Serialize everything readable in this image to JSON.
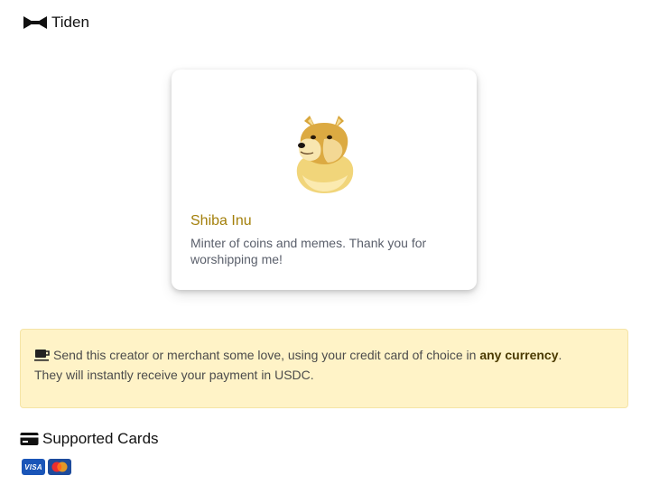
{
  "header": {
    "brand": "Tiden",
    "logo_icon": "bowtie-logo-icon"
  },
  "creator": {
    "name": "Shiba Inu",
    "bio": "Minter of coins and memes. Thank you for worshipping me!",
    "avatar_icon": "shiba-inu-avatar"
  },
  "info": {
    "icon": "coffee-icon",
    "text_before": "Send this creator or merchant some love, using your credit card of choice in ",
    "text_bold": "any currency",
    "text_after": ".",
    "line2": "They will instantly receive your payment in USDC."
  },
  "supported_cards": {
    "heading": "Supported Cards",
    "icon": "credit-card-icon",
    "cards": [
      {
        "name": "visa",
        "label": "VISA"
      },
      {
        "name": "mastercard",
        "label": ""
      }
    ]
  },
  "colors": {
    "creator_name": "#a37f0a",
    "info_background": "#fff3c7",
    "visa_blue": "#1a55b8"
  }
}
